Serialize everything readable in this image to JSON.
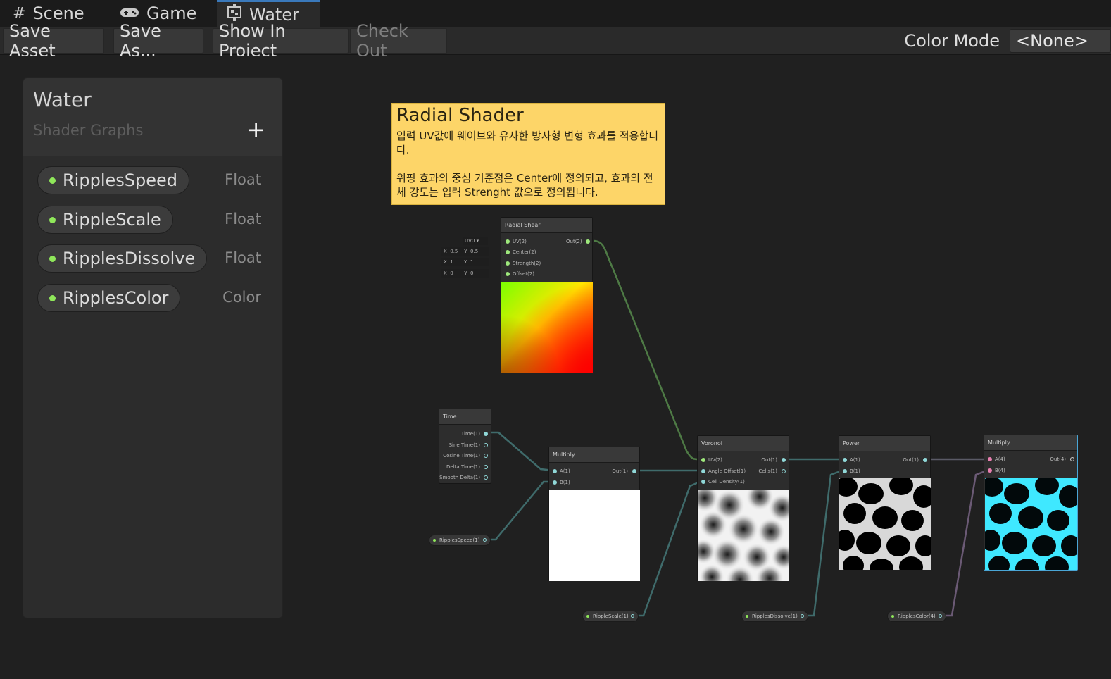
{
  "tabs": [
    {
      "label": "Scene",
      "icon": "grid-icon"
    },
    {
      "label": "Game",
      "icon": "gamepad-icon"
    },
    {
      "label": "Water",
      "icon": "shadergraph-icon"
    }
  ],
  "toolbar": {
    "save_asset": "Save Asset",
    "save_as": "Save As...",
    "show_in_project": "Show In Project",
    "check_out": "Check Out",
    "color_mode_label": "Color Mode",
    "color_mode_value": "<None>"
  },
  "blackboard": {
    "title": "Water",
    "subtitle": "Shader Graphs",
    "add": "+",
    "properties": [
      {
        "name": "RipplesSpeed",
        "type": "Float"
      },
      {
        "name": "RippleScale",
        "type": "Float"
      },
      {
        "name": "RipplesDissolve",
        "type": "Float"
      },
      {
        "name": "RipplesColor",
        "type": "Color"
      }
    ]
  },
  "sticky": {
    "title": "Radial Shader",
    "body": "입력 UV값에 웨이브와 유사한 방사형 변형 효과를 적용합니다.\n\n워핑 효과의 중심 기준점은 Center에 정의되고, 효과의 전체 강도는 입력 Strenght 값으로 정의됩니다."
  },
  "nodes": {
    "radial_shear": {
      "title": "Radial Shear",
      "inputs": [
        "UV(2)",
        "Center(2)",
        "Strength(2)",
        "Offset(2)"
      ],
      "output": "Out(2)",
      "uv_dropdown": "UV0",
      "center": {
        "x_label": "X",
        "x": "0.5",
        "y_label": "Y",
        "y": "0.5"
      },
      "strength": {
        "x_label": "X",
        "x": "1",
        "y_label": "Y",
        "y": "1"
      },
      "offset": {
        "x_label": "X",
        "x": "0",
        "y_label": "Y",
        "y": "0"
      }
    },
    "time": {
      "title": "Time",
      "outputs": [
        "Time(1)",
        "Sine Time(1)",
        "Cosine Time(1)",
        "Delta Time(1)",
        "Smooth Delta(1)"
      ]
    },
    "multiply1": {
      "title": "Multiply",
      "inputs": [
        "A(1)",
        "B(1)"
      ],
      "output": "Out(1)"
    },
    "voronoi": {
      "title": "Voronoi",
      "inputs": [
        "UV(2)",
        "Angle Offset(1)",
        "Cell Density(1)"
      ],
      "outputs": [
        "Out(1)",
        "Cells(1)"
      ]
    },
    "power": {
      "title": "Power",
      "inputs": [
        "A(1)",
        "B(1)"
      ],
      "output": "Out(1)"
    },
    "multiply2": {
      "title": "Multiply",
      "inputs": [
        "A(4)",
        "B(4)"
      ],
      "output": "Out(4)"
    }
  },
  "property_nodes": {
    "speed": "RipplesSpeed(1)",
    "scale": "RippleScale(1)",
    "dissolve": "RipplesDissolve(1)",
    "color": "RipplesColor(4)"
  },
  "colors": {
    "accent_tab": "#3a79bb",
    "sticky": "#fdd568",
    "property_dot": "#8fe75a",
    "wire_float": "#3f6b6b",
    "wire_vec2": "#4e7a45",
    "wire_vec4": "#6b5a75",
    "selected_border": "#4aa6d6"
  }
}
